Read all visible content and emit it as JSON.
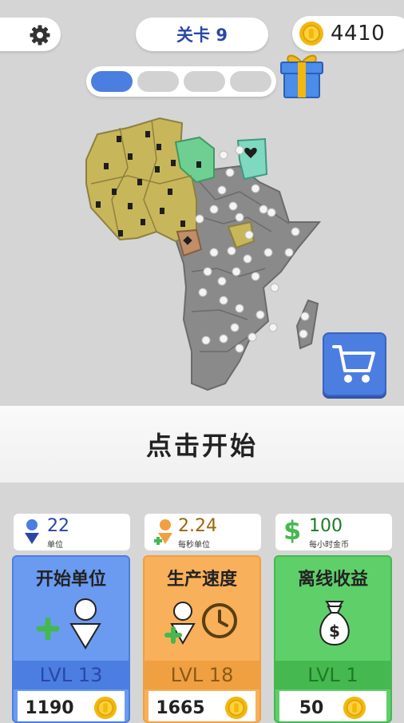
{
  "header": {
    "level_label": "关卡 9",
    "coins": "4410"
  },
  "progress": {
    "segments": 4,
    "filled": 1
  },
  "prompt": "点击开始",
  "stats": [
    {
      "value": "22",
      "label": "单位",
      "color": "#2a47a8"
    },
    {
      "value": "2.24",
      "label": "每秒单位",
      "color": "#a0640c"
    },
    {
      "value": "100",
      "label": "每小时金币",
      "color": "#1f7a28"
    }
  ],
  "cards": [
    {
      "title": "开始单位",
      "level": "LVL 13",
      "cost": "1190"
    },
    {
      "title": "生产速度",
      "level": "LVL 18",
      "cost": "1665"
    },
    {
      "title": "离线收益",
      "level": "LVL 1",
      "cost": "50"
    }
  ],
  "colors": {
    "blue": "#4b7ee0",
    "orange": "#f0a040",
    "green": "#45b850",
    "coin": "#f2b80f",
    "territory_yellow": "#c8b65a",
    "territory_grey": "#8a8a8a"
  }
}
